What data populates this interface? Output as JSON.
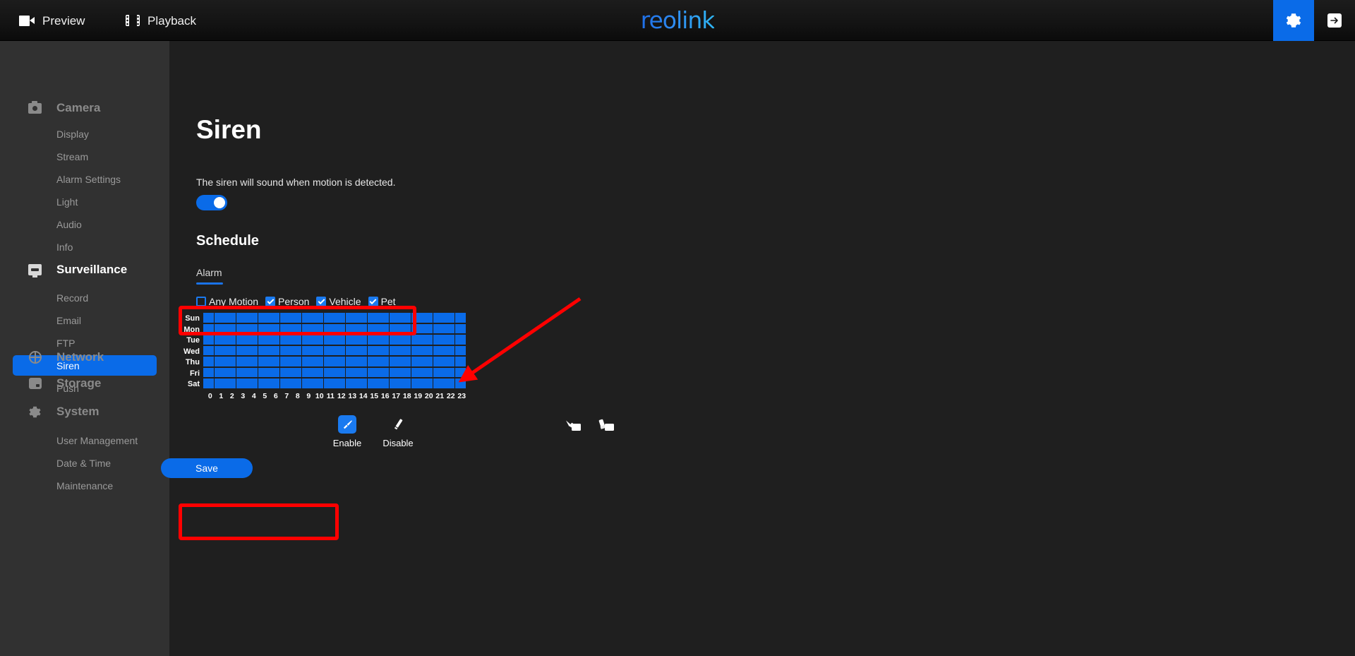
{
  "topbar": {
    "nav": [
      {
        "label": "Preview",
        "icon": "camera-icon"
      },
      {
        "label": "Playback",
        "icon": "film-icon"
      }
    ],
    "brand": "reolink",
    "settings_icon": "gear-icon",
    "logout_icon": "exit-arrow-icon",
    "accent": "#0a6be8"
  },
  "sidebar": {
    "groups": [
      {
        "label": "Camera",
        "icon": "camera-icon",
        "active": false,
        "items": [
          {
            "label": "Display",
            "selected": false
          },
          {
            "label": "Stream",
            "selected": false
          },
          {
            "label": "Alarm Settings",
            "selected": false
          },
          {
            "label": "Light",
            "selected": false
          },
          {
            "label": "Audio",
            "selected": false
          },
          {
            "label": "Info",
            "selected": false
          }
        ]
      },
      {
        "label": "Surveillance",
        "icon": "monitor-icon",
        "active": true,
        "items": [
          {
            "label": "Record",
            "selected": false
          },
          {
            "label": "Email",
            "selected": false
          },
          {
            "label": "FTP",
            "selected": false
          },
          {
            "label": "Siren",
            "selected": true
          },
          {
            "label": "Push",
            "selected": false
          }
        ]
      },
      {
        "label": "Network",
        "icon": "globe-icon",
        "active": false,
        "items": []
      },
      {
        "label": "Storage",
        "icon": "storage-icon",
        "active": false,
        "items": []
      },
      {
        "label": "System",
        "icon": "gear-icon",
        "active": false,
        "items": [
          {
            "label": "User Management",
            "selected": false
          },
          {
            "label": "Date & Time",
            "selected": false
          },
          {
            "label": "Maintenance",
            "selected": false
          }
        ]
      }
    ]
  },
  "main": {
    "page_title": "Siren",
    "siren_description": "The siren will sound when motion is detected.",
    "siren_enabled": true,
    "section_title": "Schedule",
    "tab": {
      "label": "Alarm",
      "selected": true
    },
    "filters": [
      {
        "label": "Any Motion",
        "checked": false
      },
      {
        "label": "Person",
        "checked": true
      },
      {
        "label": "Vehicle",
        "checked": true
      },
      {
        "label": "Pet",
        "checked": true
      }
    ],
    "schedule": {
      "days": [
        "Sun",
        "Mon",
        "Tue",
        "Wed",
        "Thu",
        "Fri",
        "Sat"
      ],
      "hours": [
        "0",
        "1",
        "2",
        "3",
        "4",
        "5",
        "6",
        "7",
        "8",
        "9",
        "10",
        "11",
        "12",
        "13",
        "14",
        "15",
        "16",
        "17",
        "18",
        "19",
        "20",
        "21",
        "22",
        "23"
      ],
      "cells": [
        [
          1,
          1,
          1,
          1,
          1,
          1,
          1,
          1,
          1,
          1,
          1,
          1,
          1,
          1,
          1,
          1,
          1,
          1,
          1,
          1,
          1,
          1,
          1,
          1
        ],
        [
          1,
          1,
          1,
          1,
          1,
          1,
          1,
          1,
          1,
          1,
          1,
          1,
          1,
          1,
          1,
          1,
          1,
          1,
          1,
          1,
          1,
          1,
          1,
          1
        ],
        [
          1,
          1,
          1,
          1,
          1,
          1,
          1,
          1,
          1,
          1,
          1,
          1,
          1,
          1,
          1,
          1,
          1,
          1,
          1,
          1,
          1,
          1,
          1,
          1
        ],
        [
          1,
          1,
          1,
          1,
          1,
          1,
          1,
          1,
          1,
          1,
          1,
          1,
          1,
          1,
          1,
          1,
          1,
          1,
          1,
          1,
          1,
          1,
          1,
          1
        ],
        [
          1,
          1,
          1,
          1,
          1,
          1,
          1,
          1,
          1,
          1,
          1,
          1,
          1,
          1,
          1,
          1,
          1,
          1,
          1,
          1,
          1,
          1,
          1,
          1
        ],
        [
          1,
          1,
          1,
          1,
          1,
          1,
          1,
          1,
          1,
          1,
          1,
          1,
          1,
          1,
          1,
          1,
          1,
          1,
          1,
          1,
          1,
          1,
          1,
          1
        ],
        [
          1,
          1,
          1,
          1,
          1,
          1,
          1,
          1,
          1,
          1,
          1,
          1,
          1,
          1,
          1,
          1,
          1,
          1,
          1,
          1,
          1,
          1,
          1,
          1
        ]
      ],
      "on_color": "#0a6be8",
      "off_color": "#3a3a3a"
    },
    "tools": [
      {
        "label": "Enable",
        "icon": "brush-icon",
        "active": true
      },
      {
        "label": "Disable",
        "icon": "eraser-icon",
        "active": false
      }
    ],
    "cursor_hints": [
      {
        "icon": "cursor-brush-icon"
      },
      {
        "icon": "cursor-eraser-icon"
      }
    ],
    "save_label": "Save"
  },
  "annotations": {
    "highlight_color": "#ff0000",
    "boxes": [
      {
        "name": "filters-highlight"
      },
      {
        "name": "save-highlight"
      }
    ],
    "arrow": {
      "name": "pointer-arrow"
    }
  }
}
